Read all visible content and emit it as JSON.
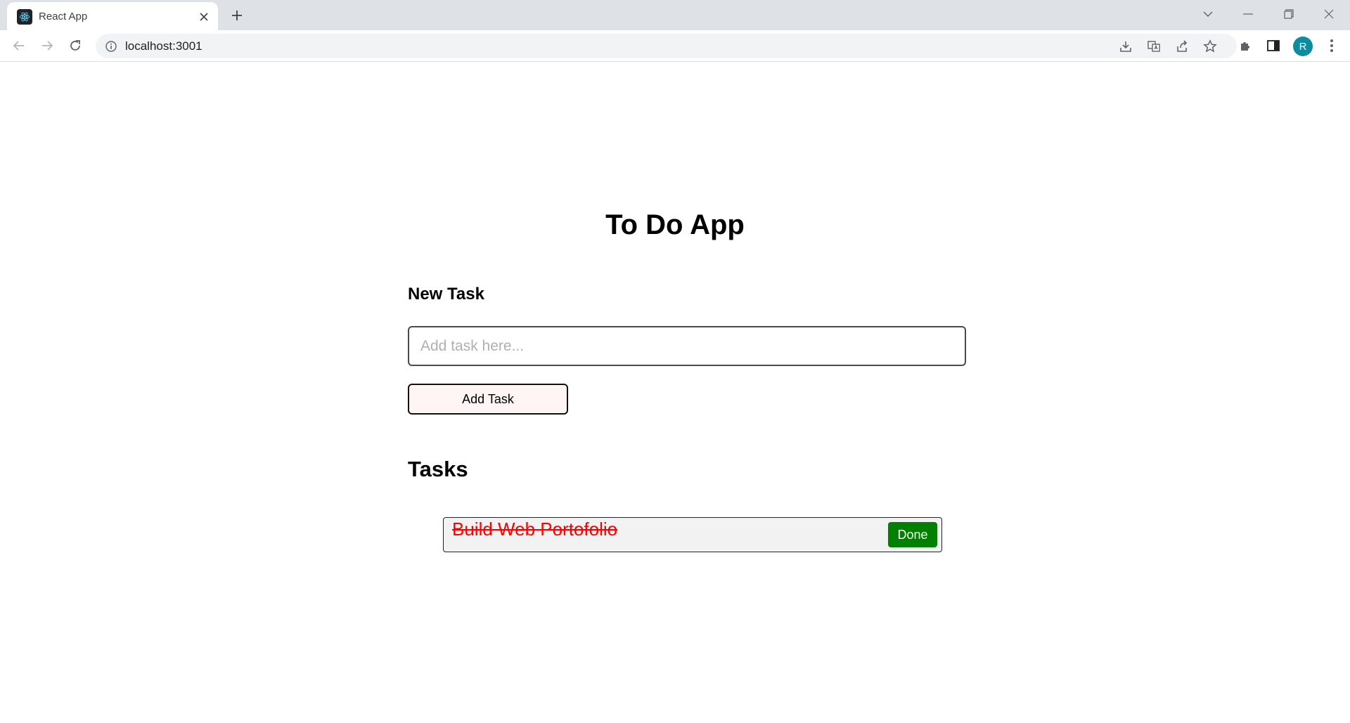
{
  "browser": {
    "tab": {
      "title": "React App"
    },
    "address_bar": {
      "url": "localhost:3001"
    },
    "profile": {
      "initial": "R",
      "color": "#0b8ca0"
    }
  },
  "app": {
    "title": "To Do App",
    "new_task": {
      "heading": "New Task",
      "input_placeholder": "Add task here...",
      "input_value": "",
      "add_button_label": "Add Task"
    },
    "tasks": {
      "heading": "Tasks",
      "items": [
        {
          "text": "Build Web Portofolio",
          "completed": true,
          "action_label": "Done"
        }
      ]
    }
  },
  "colors": {
    "completed_task_text": "#ff0000",
    "done_button": "#008000",
    "add_button_bg": "#fff5f5",
    "task_item_bg": "#f2f2f2"
  }
}
